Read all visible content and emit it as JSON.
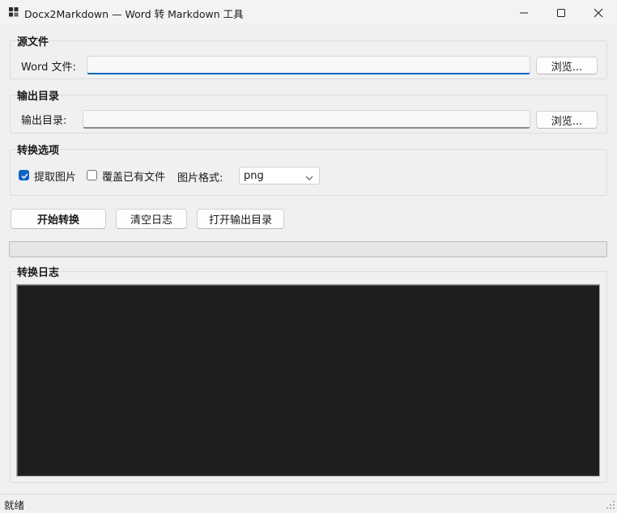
{
  "window": {
    "title": "Docx2Markdown — Word 转 Markdown 工具",
    "icon": "app-window-icon",
    "controls": [
      "minimize-icon",
      "maximize-icon",
      "close-icon"
    ]
  },
  "source_group": {
    "title": "源文件",
    "field_label": "Word 文件:",
    "value": "",
    "browse_label": "浏览..."
  },
  "output_group": {
    "title": "输出目录",
    "field_label": "输出目录:",
    "value": "",
    "browse_label": "浏览..."
  },
  "options_group": {
    "title": "转换选项",
    "extract_images": {
      "label": "提取图片",
      "checked": true
    },
    "overwrite": {
      "label": "覆盖已有文件",
      "checked": false
    },
    "image_format_label": "图片格式:",
    "image_format_value": "png"
  },
  "actions": {
    "start_label": "开始转换",
    "clear_log_label": "清空日志",
    "open_output_label": "打开输出目录"
  },
  "progress": {
    "value": 0
  },
  "log_group": {
    "title": "转换日志",
    "content": ""
  },
  "status_bar": {
    "text": "就绪"
  },
  "colors": {
    "accent": "#0c63c5",
    "log_background": "#1e1e1e",
    "window_background": "#f0f0f0"
  }
}
